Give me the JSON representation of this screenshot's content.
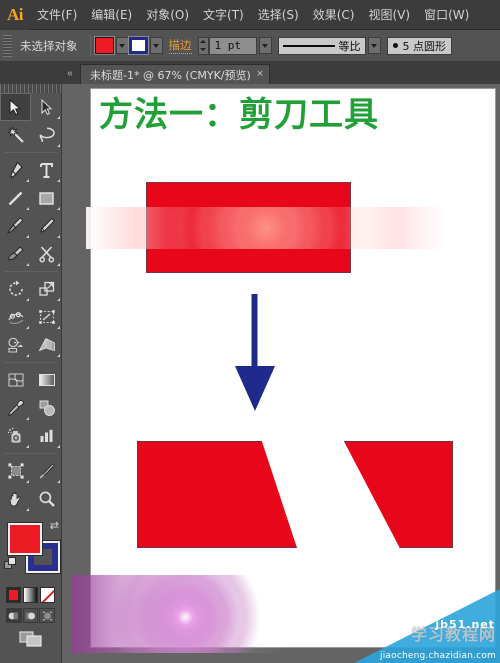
{
  "app": {
    "logo": "Ai",
    "menus": [
      {
        "label": "文件(F)",
        "name": "menu-file"
      },
      {
        "label": "编辑(E)",
        "name": "menu-edit"
      },
      {
        "label": "对象(O)",
        "name": "menu-object"
      },
      {
        "label": "文字(T)",
        "name": "menu-type"
      },
      {
        "label": "选择(S)",
        "name": "menu-select"
      },
      {
        "label": "效果(C)",
        "name": "menu-effect"
      },
      {
        "label": "视图(V)",
        "name": "menu-view"
      },
      {
        "label": "窗口(W)",
        "name": "menu-window"
      }
    ]
  },
  "control_bar": {
    "selection_status": "未选择对象",
    "fill_color": "#ed1c24",
    "stroke_color": "#1f2a8c",
    "stroke_link_label": "描边",
    "stroke_weight": "1 pt",
    "variable_width_profile": "等比",
    "brush_definition": "5 点圆形"
  },
  "tab_bar": {
    "collapse_label": "«",
    "document_tab": "未标题-1* @ 67% (CMYK/预览)",
    "close_label": "×"
  },
  "toolbar": {
    "tools": [
      {
        "name": "selection-tool",
        "label": "选择工具",
        "selected": true
      },
      {
        "name": "direct-selection-tool",
        "label": "直接选择工具",
        "selected": false
      },
      {
        "name": "magic-wand-tool",
        "label": "魔棒工具",
        "selected": false
      },
      {
        "name": "lasso-tool",
        "label": "套索工具",
        "selected": false
      },
      {
        "name": "pen-tool",
        "label": "钢笔工具",
        "selected": false
      },
      {
        "name": "type-tool",
        "label": "文字工具",
        "selected": false
      },
      {
        "name": "line-segment-tool",
        "label": "直线段工具",
        "selected": false
      },
      {
        "name": "rectangle-tool",
        "label": "矩形工具",
        "selected": false
      },
      {
        "name": "paintbrush-tool",
        "label": "画笔工具",
        "selected": false
      },
      {
        "name": "pencil-tool",
        "label": "铅笔工具",
        "selected": false
      },
      {
        "name": "blob-brush-tool",
        "label": "斑点画笔工具",
        "selected": false
      },
      {
        "name": "scissors-tool",
        "label": "剪刀工具",
        "selected": false
      },
      {
        "name": "rotate-tool",
        "label": "旋转工具",
        "selected": false
      },
      {
        "name": "scale-tool",
        "label": "比例缩放工具",
        "selected": false
      },
      {
        "name": "width-tool",
        "label": "宽度工具",
        "selected": false
      },
      {
        "name": "free-transform-tool",
        "label": "自由变换工具",
        "selected": false
      },
      {
        "name": "shape-builder-tool",
        "label": "形状生成器工具",
        "selected": false
      },
      {
        "name": "perspective-grid-tool",
        "label": "透视网格工具",
        "selected": false
      },
      {
        "name": "mesh-tool",
        "label": "网格工具",
        "selected": false
      },
      {
        "name": "gradient-tool",
        "label": "渐变工具",
        "selected": false
      },
      {
        "name": "eyedropper-tool",
        "label": "吸管工具",
        "selected": false
      },
      {
        "name": "blend-tool",
        "label": "混合工具",
        "selected": false
      },
      {
        "name": "symbol-sprayer-tool",
        "label": "符号喷枪工具",
        "selected": false
      },
      {
        "name": "column-graph-tool",
        "label": "柱形图工具",
        "selected": false
      },
      {
        "name": "artboard-tool",
        "label": "画板工具",
        "selected": false
      },
      {
        "name": "slice-tool",
        "label": "切片工具",
        "selected": false
      },
      {
        "name": "hand-tool",
        "label": "抓手工具",
        "selected": false
      },
      {
        "name": "zoom-tool",
        "label": "缩放工具",
        "selected": false
      }
    ],
    "fill_color": "#ed1c24",
    "stroke_color": "#2a2f8f",
    "swap_label": "⇄",
    "color_modes": [
      {
        "name": "color-mode-button",
        "label": "颜色"
      },
      {
        "name": "gradient-mode-button",
        "label": "渐变"
      },
      {
        "name": "none-mode-button",
        "label": "无"
      }
    ],
    "draw_modes": [
      {
        "name": "draw-normal-button",
        "label": "正常绘图",
        "active": true
      },
      {
        "name": "draw-behind-button",
        "label": "背面绘图",
        "active": false
      },
      {
        "name": "draw-inside-button",
        "label": "内部绘图",
        "active": false
      }
    ],
    "screen_mode": {
      "name": "screen-mode-button",
      "label": "更改屏幕模式"
    }
  },
  "artboard": {
    "title": "方法一：剪刀工具",
    "title_color": "#21a038",
    "shape_fill": "#e8061b",
    "arrow_color": "#1f2a8c",
    "shapes": [
      {
        "name": "source-rectangle",
        "label": "原始矩形"
      },
      {
        "name": "down-arrow",
        "label": "向下箭头"
      },
      {
        "name": "result-shape-left",
        "label": "剪切结果左"
      },
      {
        "name": "result-shape-right",
        "label": "剪切结果右"
      }
    ]
  },
  "watermarks": {
    "corner_cn": "学习教程网",
    "corner_site": "jb51.net",
    "corner_url": "jiaocheng.chazidian.com",
    "corner_color": "#2aa4dd"
  }
}
